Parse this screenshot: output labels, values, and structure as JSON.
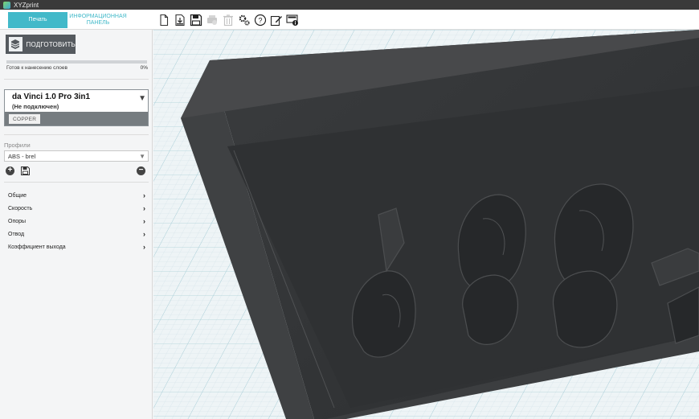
{
  "window": {
    "title": "XYZprint"
  },
  "tabs": {
    "print": "Печать",
    "dashboard": "ИНФОРМАЦИОННАЯ ПАНЕЛЬ"
  },
  "toolbar": {
    "icons": [
      "new-file-icon",
      "import-icon",
      "save-icon",
      "printer-3d-icon",
      "trash-icon",
      "gear-icon",
      "help-icon",
      "edit-icon",
      "info-icon"
    ]
  },
  "sidebar": {
    "prepare_label": "ПОДГОТОВИТЬ",
    "status_label": "Готов к нанесению слоев",
    "progress_percent": "0%",
    "progress_value": 0,
    "printer": {
      "name": "da Vinci 1.0 Pro 3in1",
      "state": "(Не подключен)",
      "material_button": "COPPER"
    },
    "profiles_label": "Профили",
    "profile_selected": "ABS - brel",
    "menu": [
      "Общие",
      "Скорость",
      "Опоры",
      "Отвод",
      "Коэффициент выхода"
    ]
  },
  "colors": {
    "accent": "#42b9c9",
    "model": "#2e3032",
    "grid_bg": "#eef4f6"
  }
}
